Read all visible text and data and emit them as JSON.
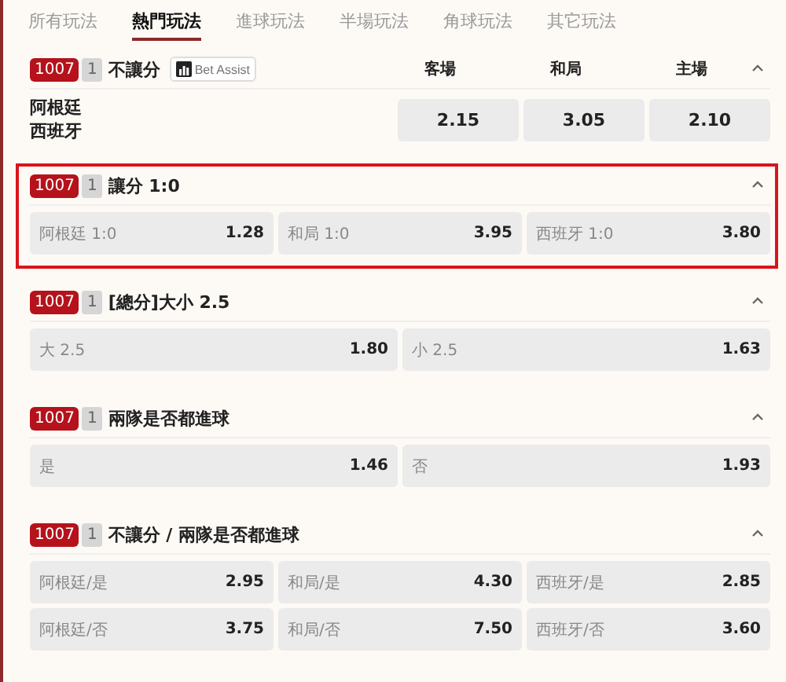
{
  "tabs": [
    {
      "label": "所有玩法",
      "selected": false
    },
    {
      "label": "熱門玩法",
      "selected": true
    },
    {
      "label": "進球玩法",
      "selected": false
    },
    {
      "label": "半場玩法",
      "selected": false
    },
    {
      "label": "角球玩法",
      "selected": false
    },
    {
      "label": "其它玩法",
      "selected": false
    }
  ],
  "markets": [
    {
      "kind": "match",
      "code": "1007",
      "number": "1",
      "title": "不讓分",
      "bet_assist": "Bet Assist",
      "highlighted": false,
      "columns": [
        "客場",
        "和局",
        "主場"
      ],
      "teams": [
        "阿根廷",
        "西班牙"
      ],
      "rows": [
        [
          {
            "odds": "2.15"
          },
          {
            "odds": "3.05"
          },
          {
            "odds": "2.10"
          }
        ]
      ]
    },
    {
      "kind": "grid",
      "code": "1007",
      "number": "1",
      "title": "讓分 1:0",
      "highlighted": true,
      "rows": [
        [
          {
            "label": "阿根廷 1:0",
            "odds": "1.28"
          },
          {
            "label": "和局 1:0",
            "odds": "3.95"
          },
          {
            "label": "西班牙 1:0",
            "odds": "3.80"
          }
        ]
      ]
    },
    {
      "kind": "grid",
      "code": "1007",
      "number": "1",
      "title": "[總分]大小 2.5",
      "highlighted": false,
      "rows": [
        [
          {
            "label": "大 2.5",
            "odds": "1.80"
          },
          {
            "label": "小 2.5",
            "odds": "1.63"
          }
        ]
      ]
    },
    {
      "kind": "grid",
      "code": "1007",
      "number": "1",
      "title": "兩隊是否都進球",
      "highlighted": false,
      "rows": [
        [
          {
            "label": "是",
            "odds": "1.46"
          },
          {
            "label": "否",
            "odds": "1.93"
          }
        ]
      ]
    },
    {
      "kind": "grid",
      "code": "1007",
      "number": "1",
      "title": "不讓分 / 兩隊是否都進球",
      "highlighted": false,
      "rows": [
        [
          {
            "label": "阿根廷/是",
            "odds": "2.95"
          },
          {
            "label": "和局/是",
            "odds": "4.30"
          },
          {
            "label": "西班牙/是",
            "odds": "2.85"
          }
        ],
        [
          {
            "label": "阿根廷/否",
            "odds": "3.75"
          },
          {
            "label": "和局/否",
            "odds": "7.50"
          },
          {
            "label": "西班牙/否",
            "odds": "3.60"
          }
        ]
      ]
    }
  ]
}
